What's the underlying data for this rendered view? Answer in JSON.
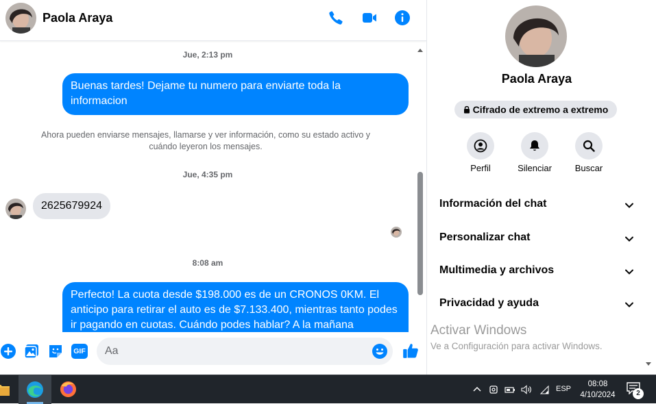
{
  "contact": {
    "name": "Paola Araya"
  },
  "header": {
    "icons": [
      "phone-icon",
      "video-camera-icon",
      "info-icon"
    ]
  },
  "messages": {
    "ts1": "Jue, 2:13 pm",
    "msg1": "Buenas tardes! Dejame tu numero para enviarte toda la informacion",
    "system": "Ahora pueden enviarse mensajes, llamarse y ver información, como su estado activo y cuándo leyeron los mensajes.",
    "ts2": "Jue, 4:35 pm",
    "msg2": "2625679924",
    "ts3": "8:08 am",
    "msg3": "Perfecto! La cuota desde $198.000 es de un CRONOS 0KM. El anticipo para retirar el auto es de $7.133.400, mientras tanto podes ir pagando en cuotas. Cuándo podes hablar? A la mañana"
  },
  "composer": {
    "placeholder": "Aa",
    "icons": [
      "plus-icon",
      "photo-icon",
      "sticker-icon",
      "gif-icon",
      "emoji-icon",
      "thumbs-up-icon"
    ],
    "gif_label": "GIF"
  },
  "info_panel": {
    "name": "Paola Araya",
    "encryption": "Cifrado de extremo a extremo",
    "actions": [
      {
        "label": "Perfil",
        "icon": "profile-icon"
      },
      {
        "label": "Silenciar",
        "icon": "bell-icon"
      },
      {
        "label": "Buscar",
        "icon": "search-icon"
      }
    ],
    "sections": [
      {
        "label": "Información del chat"
      },
      {
        "label": "Personalizar chat"
      },
      {
        "label": "Multimedia y archivos"
      },
      {
        "label": "Privacidad y ayuda"
      }
    ]
  },
  "watermark": {
    "title": "Activar Windows",
    "subtitle": "Ve a Configuración para activar Windows."
  },
  "taskbar": {
    "language": "ESP",
    "time": "08:08",
    "date": "4/10/2024",
    "notifications": "2"
  },
  "colors": {
    "accent": "#0084ff",
    "bubble_in": "#e4e6eb",
    "taskbar": "#20252b"
  }
}
